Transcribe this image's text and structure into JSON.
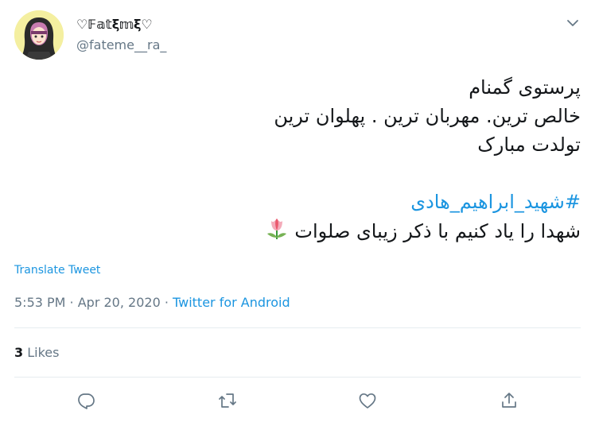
{
  "author": {
    "display_name": "♡𝔽𝕒𝕥ξ𝕞ξ♡",
    "handle": "@fateme__ra_"
  },
  "tweet": {
    "lines": [
      "پرستوی گمنام",
      "خالص ترین.  مهربان ترین . پهلوان ترین",
      "تولدت مبارک"
    ],
    "hashtag": "#شهید_ابراهیم_هادی",
    "closing": "شهدا را یاد کنیم با ذکر زیبای صلوات"
  },
  "translate_label": "Translate Tweet",
  "meta": {
    "time": "5:53 PM · Apr 20, 2020 · ",
    "source": "Twitter for Android"
  },
  "likes": {
    "count": "3",
    "label": " Likes"
  },
  "icons": {
    "caret": "chevron-down-icon",
    "reply": "reply-icon",
    "retweet": "retweet-icon",
    "like": "heart-icon",
    "share": "share-icon",
    "emoji": "tulip-icon"
  },
  "colors": {
    "link": "#1b95e0",
    "secondary": "#657786",
    "divider": "#e6ecf0",
    "text": "#14171a"
  }
}
